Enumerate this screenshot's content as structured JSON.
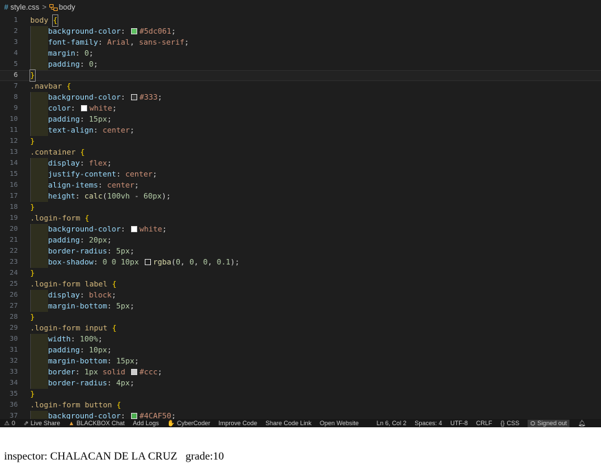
{
  "breadcrumb": {
    "file": "style.css",
    "separator": ">",
    "symbol": "body"
  },
  "colors": {
    "body_bg": "#5dc061",
    "navbar_bg": "#333",
    "white": "#ffffff",
    "shadow": "rgba(0, 0, 0, 0.1)",
    "button_bg": "#4CAF50",
    "border": "#ccc"
  },
  "lines": [
    {
      "n": "1",
      "indent": 0,
      "tokens": [
        [
          "sel-tag",
          "body"
        ],
        [
          "punc",
          " "
        ],
        [
          "brace-hl",
          "{"
        ]
      ]
    },
    {
      "n": "2",
      "indent": 1,
      "tokens": [
        [
          "prop",
          "background-color"
        ],
        [
          "punc",
          ": "
        ],
        [
          "swatch",
          "#5dc061"
        ],
        [
          "val",
          "#5dc061"
        ],
        [
          "punc",
          ";"
        ]
      ]
    },
    {
      "n": "3",
      "indent": 1,
      "tokens": [
        [
          "prop",
          "font-family"
        ],
        [
          "punc",
          ": "
        ],
        [
          "val",
          "Arial"
        ],
        [
          "punc",
          ", "
        ],
        [
          "val",
          "sans-serif"
        ],
        [
          "punc",
          ";"
        ]
      ]
    },
    {
      "n": "4",
      "indent": 1,
      "tokens": [
        [
          "prop",
          "margin"
        ],
        [
          "punc",
          ": "
        ],
        [
          "num",
          "0"
        ],
        [
          "punc",
          ";"
        ]
      ]
    },
    {
      "n": "5",
      "indent": 1,
      "tokens": [
        [
          "prop",
          "padding"
        ],
        [
          "punc",
          ": "
        ],
        [
          "num",
          "0"
        ],
        [
          "punc",
          ";"
        ]
      ]
    },
    {
      "n": "6",
      "indent": 0,
      "active": true,
      "tokens": [
        [
          "brace-hl",
          "}"
        ]
      ]
    },
    {
      "n": "7",
      "indent": 0,
      "tokens": [
        [
          "sel",
          ".navbar"
        ],
        [
          "punc",
          " "
        ],
        [
          "brace",
          "{"
        ]
      ]
    },
    {
      "n": "8",
      "indent": 1,
      "tokens": [
        [
          "prop",
          "background-color"
        ],
        [
          "punc",
          ": "
        ],
        [
          "swatch",
          "#333333"
        ],
        [
          "val",
          "#333"
        ],
        [
          "punc",
          ";"
        ]
      ]
    },
    {
      "n": "9",
      "indent": 1,
      "tokens": [
        [
          "prop",
          "color"
        ],
        [
          "punc",
          ": "
        ],
        [
          "swatch",
          "#ffffff"
        ],
        [
          "val",
          "white"
        ],
        [
          "punc",
          ";"
        ]
      ]
    },
    {
      "n": "10",
      "indent": 1,
      "tokens": [
        [
          "prop",
          "padding"
        ],
        [
          "punc",
          ": "
        ],
        [
          "num",
          "15px"
        ],
        [
          "punc",
          ";"
        ]
      ]
    },
    {
      "n": "11",
      "indent": 1,
      "tokens": [
        [
          "prop",
          "text-align"
        ],
        [
          "punc",
          ": "
        ],
        [
          "val",
          "center"
        ],
        [
          "punc",
          ";"
        ]
      ]
    },
    {
      "n": "12",
      "indent": 0,
      "tokens": [
        [
          "brace",
          "}"
        ]
      ]
    },
    {
      "n": "13",
      "indent": 0,
      "tokens": [
        [
          "sel",
          ".container"
        ],
        [
          "punc",
          " "
        ],
        [
          "brace",
          "{"
        ]
      ]
    },
    {
      "n": "14",
      "indent": 1,
      "tokens": [
        [
          "prop",
          "display"
        ],
        [
          "punc",
          ": "
        ],
        [
          "val",
          "flex"
        ],
        [
          "punc",
          ";"
        ]
      ]
    },
    {
      "n": "15",
      "indent": 1,
      "tokens": [
        [
          "prop",
          "justify-content"
        ],
        [
          "punc",
          ": "
        ],
        [
          "val",
          "center"
        ],
        [
          "punc",
          ";"
        ]
      ]
    },
    {
      "n": "16",
      "indent": 1,
      "tokens": [
        [
          "prop",
          "align-items"
        ],
        [
          "punc",
          ": "
        ],
        [
          "val",
          "center"
        ],
        [
          "punc",
          ";"
        ]
      ]
    },
    {
      "n": "17",
      "indent": 1,
      "tokens": [
        [
          "prop",
          "height"
        ],
        [
          "punc",
          ": "
        ],
        [
          "fn",
          "calc"
        ],
        [
          "punc",
          "("
        ],
        [
          "num",
          "100vh"
        ],
        [
          "punc",
          " - "
        ],
        [
          "num",
          "60px"
        ],
        [
          "punc",
          ");"
        ]
      ]
    },
    {
      "n": "18",
      "indent": 0,
      "tokens": [
        [
          "brace",
          "}"
        ]
      ]
    },
    {
      "n": "19",
      "indent": 0,
      "tokens": [
        [
          "sel",
          ".login-form"
        ],
        [
          "punc",
          " "
        ],
        [
          "brace",
          "{"
        ]
      ]
    },
    {
      "n": "20",
      "indent": 1,
      "tokens": [
        [
          "prop",
          "background-color"
        ],
        [
          "punc",
          ": "
        ],
        [
          "swatch",
          "#ffffff"
        ],
        [
          "val",
          "white"
        ],
        [
          "punc",
          ";"
        ]
      ]
    },
    {
      "n": "21",
      "indent": 1,
      "tokens": [
        [
          "prop",
          "padding"
        ],
        [
          "punc",
          ": "
        ],
        [
          "num",
          "20px"
        ],
        [
          "punc",
          ";"
        ]
      ]
    },
    {
      "n": "22",
      "indent": 1,
      "tokens": [
        [
          "prop",
          "border-radius"
        ],
        [
          "punc",
          ": "
        ],
        [
          "num",
          "5px"
        ],
        [
          "punc",
          ";"
        ]
      ]
    },
    {
      "n": "23",
      "indent": 1,
      "tokens": [
        [
          "prop",
          "box-shadow"
        ],
        [
          "punc",
          ": "
        ],
        [
          "num",
          "0 0 10px"
        ],
        [
          "punc",
          " "
        ],
        [
          "swatch",
          "#1e1e1e"
        ],
        [
          "fn",
          "rgba"
        ],
        [
          "punc",
          "("
        ],
        [
          "num",
          "0"
        ],
        [
          "punc",
          ", "
        ],
        [
          "num",
          "0"
        ],
        [
          "punc",
          ", "
        ],
        [
          "num",
          "0"
        ],
        [
          "punc",
          ", "
        ],
        [
          "num",
          "0.1"
        ],
        [
          "punc",
          ");"
        ]
      ]
    },
    {
      "n": "24",
      "indent": 0,
      "tokens": [
        [
          "brace",
          "}"
        ]
      ]
    },
    {
      "n": "25",
      "indent": 0,
      "tokens": [
        [
          "sel",
          ".login-form label"
        ],
        [
          "punc",
          " "
        ],
        [
          "brace",
          "{"
        ]
      ]
    },
    {
      "n": "26",
      "indent": 1,
      "tokens": [
        [
          "prop",
          "display"
        ],
        [
          "punc",
          ": "
        ],
        [
          "val",
          "block"
        ],
        [
          "punc",
          ";"
        ]
      ]
    },
    {
      "n": "27",
      "indent": 1,
      "tokens": [
        [
          "prop",
          "margin-bottom"
        ],
        [
          "punc",
          ": "
        ],
        [
          "num",
          "5px"
        ],
        [
          "punc",
          ";"
        ]
      ]
    },
    {
      "n": "28",
      "indent": 0,
      "tokens": [
        [
          "brace",
          "}"
        ]
      ]
    },
    {
      "n": "29",
      "indent": 0,
      "tokens": [
        [
          "sel",
          ".login-form input"
        ],
        [
          "punc",
          " "
        ],
        [
          "brace",
          "{"
        ]
      ]
    },
    {
      "n": "30",
      "indent": 1,
      "tokens": [
        [
          "prop",
          "width"
        ],
        [
          "punc",
          ": "
        ],
        [
          "num",
          "100%"
        ],
        [
          "punc",
          ";"
        ]
      ]
    },
    {
      "n": "31",
      "indent": 1,
      "tokens": [
        [
          "prop",
          "padding"
        ],
        [
          "punc",
          ": "
        ],
        [
          "num",
          "10px"
        ],
        [
          "punc",
          ";"
        ]
      ]
    },
    {
      "n": "32",
      "indent": 1,
      "tokens": [
        [
          "prop",
          "margin-bottom"
        ],
        [
          "punc",
          ": "
        ],
        [
          "num",
          "15px"
        ],
        [
          "punc",
          ";"
        ]
      ]
    },
    {
      "n": "33",
      "indent": 1,
      "tokens": [
        [
          "prop",
          "border"
        ],
        [
          "punc",
          ": "
        ],
        [
          "num",
          "1px"
        ],
        [
          "punc",
          " "
        ],
        [
          "val",
          "solid"
        ],
        [
          "punc",
          " "
        ],
        [
          "swatch",
          "#cccccc"
        ],
        [
          "val",
          "#ccc"
        ],
        [
          "punc",
          ";"
        ]
      ]
    },
    {
      "n": "34",
      "indent": 1,
      "tokens": [
        [
          "prop",
          "border-radius"
        ],
        [
          "punc",
          ": "
        ],
        [
          "num",
          "4px"
        ],
        [
          "punc",
          ";"
        ]
      ]
    },
    {
      "n": "35",
      "indent": 0,
      "tokens": [
        [
          "brace",
          "}"
        ]
      ]
    },
    {
      "n": "36",
      "indent": 0,
      "tokens": [
        [
          "sel",
          ".login-form button"
        ],
        [
          "punc",
          " "
        ],
        [
          "brace",
          "{"
        ]
      ]
    },
    {
      "n": "37",
      "indent": 1,
      "tokens": [
        [
          "prop",
          "background-color"
        ],
        [
          "punc",
          ": "
        ],
        [
          "swatch",
          "#4CAF50"
        ],
        [
          "val",
          "#4CAF50"
        ],
        [
          "punc",
          ";"
        ]
      ]
    }
  ],
  "statusbar": {
    "warnings": "0",
    "live_share": "Live Share",
    "blackbox": "BLACKBOX Chat",
    "add_logs": "Add Logs",
    "cybercoder": "CyberCoder",
    "improve_code": "Improve Code",
    "share_code_link": "Share Code Link",
    "open_website": "Open Website",
    "position": "Ln 6, Col 2",
    "spaces": "Spaces: 4",
    "encoding": "UTF-8",
    "eol": "CRLF",
    "language": "CSS",
    "signed_out": "Signed out"
  },
  "caption": "inspector: CHALACAN DE LA CRUZ   grade:10"
}
